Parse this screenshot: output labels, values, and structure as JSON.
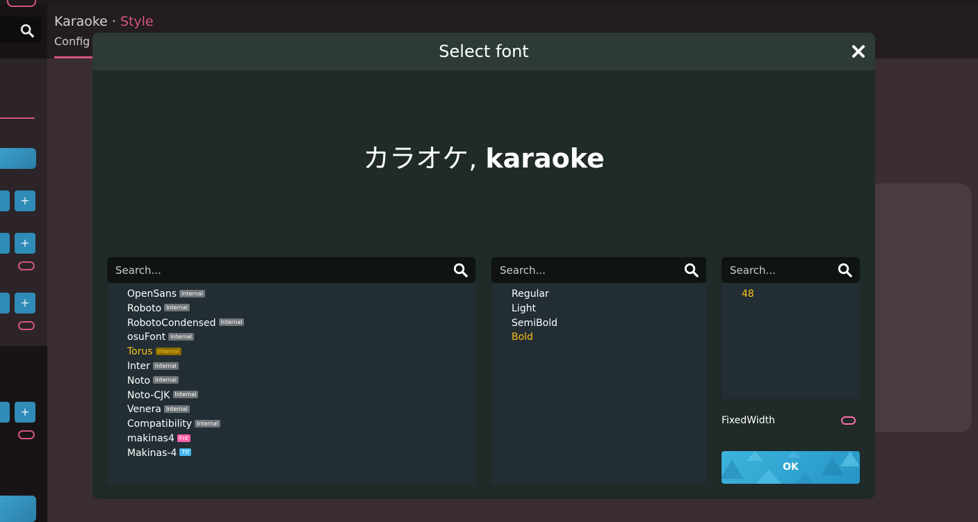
{
  "background": {
    "title_main": "Karaoke",
    "title_separator": " · ",
    "title_sub": "Style",
    "tab_label": "Config",
    "button_plus": "+",
    "button_minus": "-"
  },
  "dialog": {
    "title": "Select font",
    "preview_text_cjk": "カラオケ, ",
    "preview_text_latin": "karaoke",
    "font_search": {
      "placeholder": "Search..."
    },
    "fonts": [
      {
        "name": "OpenSans",
        "badge": "Internal",
        "badge_type": "internal",
        "selected": false
      },
      {
        "name": "Roboto",
        "badge": "Internal",
        "badge_type": "internal",
        "selected": false
      },
      {
        "name": "RobotoCondensed",
        "badge": "Internal",
        "badge_type": "internal",
        "selected": false
      },
      {
        "name": "osuFont",
        "badge": "Internal",
        "badge_type": "internal",
        "selected": false
      },
      {
        "name": "Torus",
        "badge": "Internal",
        "badge_type": "internal",
        "selected": true
      },
      {
        "name": "Inter",
        "badge": "Internal",
        "badge_type": "internal",
        "selected": false
      },
      {
        "name": "Noto",
        "badge": "Internal",
        "badge_type": "internal",
        "selected": false
      },
      {
        "name": "Noto-CJK",
        "badge": "Internal",
        "badge_type": "internal",
        "selected": false
      },
      {
        "name": "Venera",
        "badge": "Internal",
        "badge_type": "internal",
        "selected": false
      },
      {
        "name": "Compatibility",
        "badge": "Internal",
        "badge_type": "internal",
        "selected": false
      },
      {
        "name": "makinas4",
        "badge": "Fnt",
        "badge_type": "fnt",
        "selected": false
      },
      {
        "name": "Makinas-4",
        "badge": "Ttf",
        "badge_type": "ttf",
        "selected": false
      }
    ],
    "weight_search": {
      "placeholder": "Search..."
    },
    "weights": [
      {
        "name": "Regular",
        "selected": false
      },
      {
        "name": "Light",
        "selected": false
      },
      {
        "name": "SemiBold",
        "selected": false
      },
      {
        "name": "Bold",
        "selected": true
      }
    ],
    "size_search": {
      "placeholder": "Search..."
    },
    "sizes": [
      {
        "name": "48",
        "selected": true
      }
    ],
    "fixed_width_label": "FixedWidth",
    "fixed_width_enabled": false,
    "ok_label": "OK"
  },
  "colors": {
    "accent_pink": "#d4567f",
    "selected_yellow": "#f7c318",
    "ok_blue": "#2f9fd0"
  },
  "icons": {
    "close": "close-icon",
    "search": "search-icon"
  }
}
